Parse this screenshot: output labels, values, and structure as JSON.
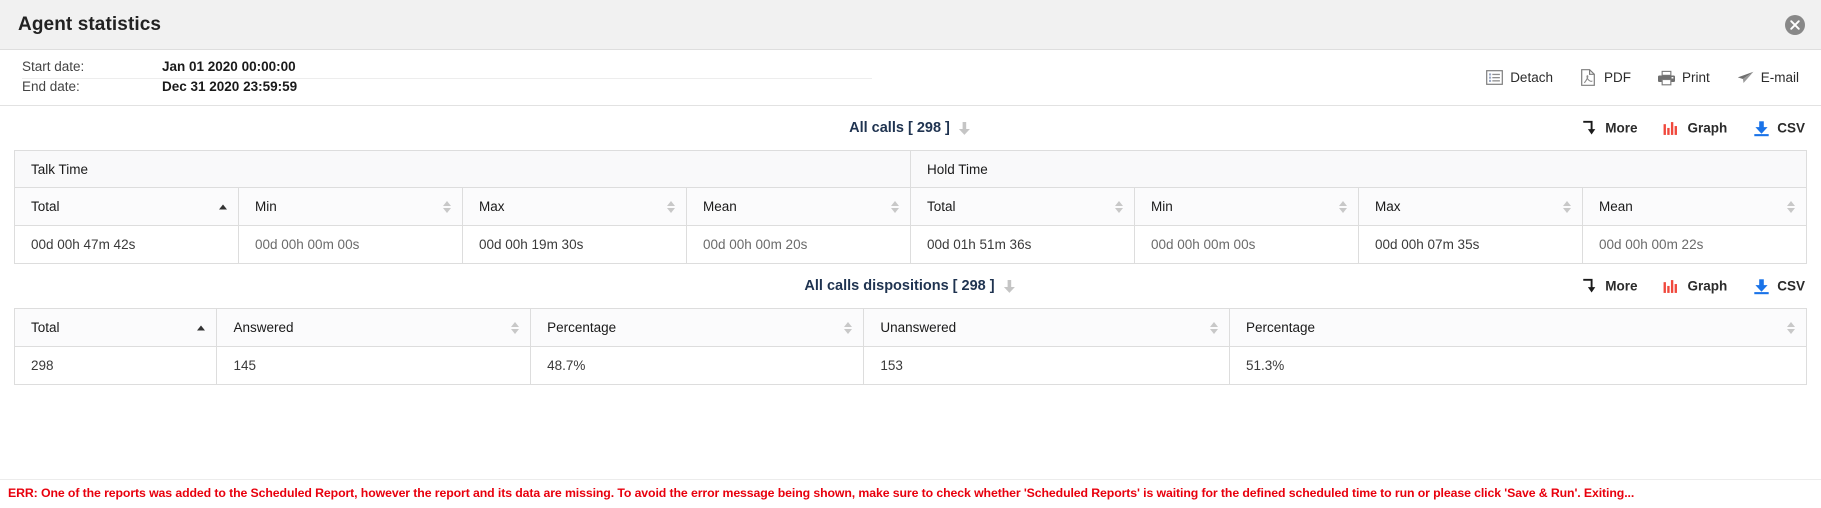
{
  "window": {
    "title": "Agent statistics",
    "close_icon": "close-circle-icon"
  },
  "meta": {
    "start_label": "Start date:",
    "start_value": "Jan 01 2020 00:00:00",
    "end_label": "End date:",
    "end_value": "Dec 31 2020 23:59:59"
  },
  "toolbar": {
    "detach_label": "Detach",
    "pdf_label": "PDF",
    "print_label": "Print",
    "email_label": "E-mail"
  },
  "actions": {
    "more_label": "More",
    "graph_label": "Graph",
    "csv_label": "CSV"
  },
  "colors": {
    "accent_blue": "#1a73e8",
    "graph_red": "#f0483c",
    "error_red": "#e8000d",
    "title_navy": "#1f3350",
    "header_bg": "#f1f1f1"
  },
  "sections": [
    {
      "title": "All calls [ 298 ]",
      "groups": [
        {
          "label": "Talk Time",
          "span": 4
        },
        {
          "label": "Hold Time",
          "span": 4
        }
      ],
      "columns": [
        {
          "label": "Total",
          "sorted": "asc"
        },
        {
          "label": "Min",
          "sorted": "none"
        },
        {
          "label": "Max",
          "sorted": "none"
        },
        {
          "label": "Mean",
          "sorted": "none"
        },
        {
          "label": "Total",
          "sorted": "none"
        },
        {
          "label": "Min",
          "sorted": "none"
        },
        {
          "label": "Max",
          "sorted": "none"
        },
        {
          "label": "Mean",
          "sorted": "none"
        }
      ],
      "rows": [
        [
          "00d 00h 47m 42s",
          "00d 00h 00m 00s",
          "00d 00h 19m 30s",
          "00d 00h 00m 20s",
          "00d 01h 51m 36s",
          "00d 00h 00m 00s",
          "00d 00h 07m 35s",
          "00d 00h 00m 22s"
        ]
      ]
    },
    {
      "title": "All calls dispositions [ 298 ]",
      "groups": [],
      "columns": [
        {
          "label": "Total",
          "sorted": "asc"
        },
        {
          "label": "Answered",
          "sorted": "none"
        },
        {
          "label": "Percentage",
          "sorted": "none"
        },
        {
          "label": "Unanswered",
          "sorted": "none"
        },
        {
          "label": "Percentage",
          "sorted": "none"
        }
      ],
      "rows": [
        [
          "298",
          "145",
          "48.7%",
          "153",
          "51.3%"
        ]
      ]
    }
  ],
  "error": {
    "message": "ERR: One of the reports was added to the Scheduled Report, however the report and its data are missing. To avoid the error message being shown, make sure to check whether 'Scheduled Reports' is waiting for the defined scheduled time to run or please click 'Save & Run'. Exiting..."
  }
}
